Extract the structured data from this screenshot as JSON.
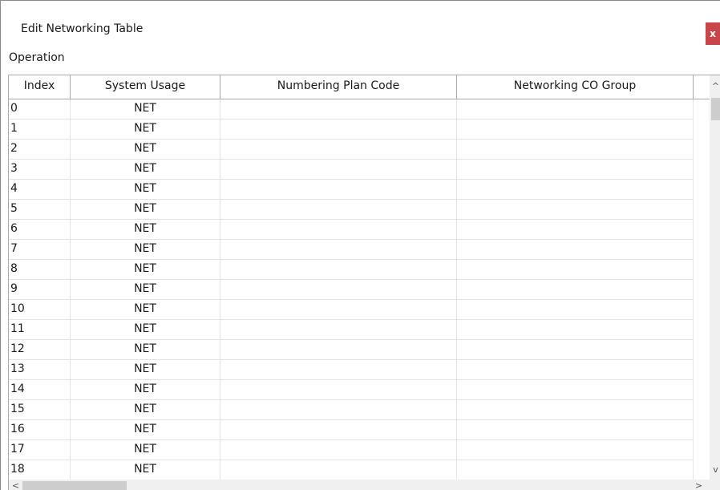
{
  "window": {
    "title": "Edit Networking Table",
    "close_label": "x"
  },
  "menu": {
    "items": [
      "Operation"
    ]
  },
  "table": {
    "columns": [
      "Index",
      "System Usage",
      "Numbering Plan Code",
      "Networking CO Group"
    ],
    "rows": [
      {
        "index": "0",
        "usage": "NET",
        "plan": "",
        "group": ""
      },
      {
        "index": "1",
        "usage": "NET",
        "plan": "",
        "group": ""
      },
      {
        "index": "2",
        "usage": "NET",
        "plan": "",
        "group": ""
      },
      {
        "index": "3",
        "usage": "NET",
        "plan": "",
        "group": ""
      },
      {
        "index": "4",
        "usage": "NET",
        "plan": "",
        "group": ""
      },
      {
        "index": "5",
        "usage": "NET",
        "plan": "",
        "group": ""
      },
      {
        "index": "6",
        "usage": "NET",
        "plan": "",
        "group": ""
      },
      {
        "index": "7",
        "usage": "NET",
        "plan": "",
        "group": ""
      },
      {
        "index": "8",
        "usage": "NET",
        "plan": "",
        "group": ""
      },
      {
        "index": "9",
        "usage": "NET",
        "plan": "",
        "group": ""
      },
      {
        "index": "10",
        "usage": "NET",
        "plan": "",
        "group": ""
      },
      {
        "index": "11",
        "usage": "NET",
        "plan": "",
        "group": ""
      },
      {
        "index": "12",
        "usage": "NET",
        "plan": "",
        "group": ""
      },
      {
        "index": "13",
        "usage": "NET",
        "plan": "",
        "group": ""
      },
      {
        "index": "14",
        "usage": "NET",
        "plan": "",
        "group": ""
      },
      {
        "index": "15",
        "usage": "NET",
        "plan": "",
        "group": ""
      },
      {
        "index": "16",
        "usage": "NET",
        "plan": "",
        "group": ""
      },
      {
        "index": "17",
        "usage": "NET",
        "plan": "",
        "group": ""
      },
      {
        "index": "18",
        "usage": "NET",
        "plan": "",
        "group": ""
      }
    ]
  },
  "scrollbars": {
    "up_glyph": "^",
    "down_glyph": "v",
    "left_glyph": "<",
    "right_glyph": ">"
  },
  "colors": {
    "close_button": "#c8454a"
  }
}
